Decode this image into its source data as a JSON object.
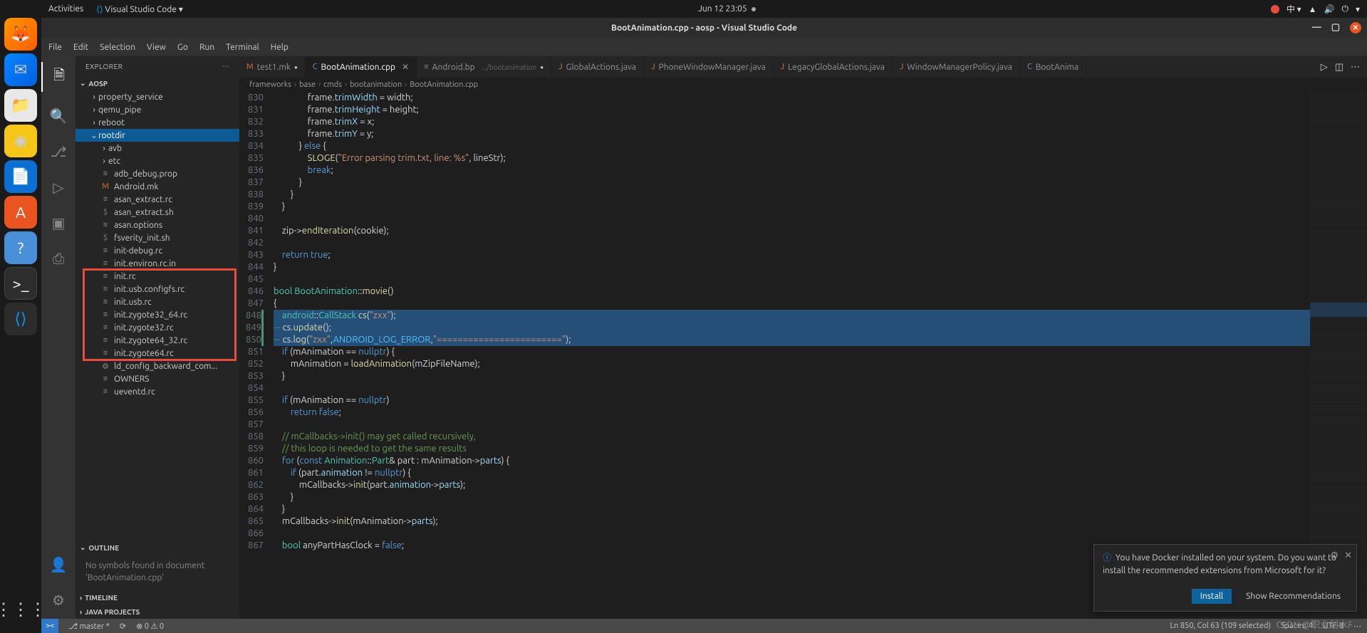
{
  "topbar": {
    "activities": "Activities",
    "app": "Visual Studio Code ▾",
    "clock": "Jun 12  23:05",
    "lang": "中 ▾"
  },
  "window": {
    "title": "BootAnimation.cpp - aosp - Visual Studio Code"
  },
  "menubar": [
    "File",
    "Edit",
    "Selection",
    "View",
    "Go",
    "Run",
    "Terminal",
    "Help"
  ],
  "sidebar": {
    "title": "EXPLORER",
    "project": "AOSP",
    "outline_head": "OUTLINE",
    "outline_empty": "No symbols found in document 'BootAnimation.cpp'",
    "timeline_head": "TIMELINE",
    "java_head": "JAVA PROJECTS",
    "tree": [
      {
        "type": "folder",
        "label": "property_service",
        "depth": 1
      },
      {
        "type": "folder",
        "label": "qemu_pipe",
        "depth": 1
      },
      {
        "type": "folder",
        "label": "reboot",
        "depth": 1
      },
      {
        "type": "folder",
        "label": "rootdir",
        "depth": 1,
        "expanded": true,
        "selected": true
      },
      {
        "type": "folder",
        "label": "avb",
        "depth": 2
      },
      {
        "type": "folder",
        "label": "etc",
        "depth": 2
      },
      {
        "type": "file",
        "label": "adb_debug.prop",
        "icon": "≡",
        "depth": 2
      },
      {
        "type": "file",
        "label": "Android.mk",
        "icon": "M",
        "color": "#e37933",
        "depth": 2
      },
      {
        "type": "file",
        "label": "asan_extract.rc",
        "icon": "≡",
        "depth": 2
      },
      {
        "type": "file",
        "label": "asan_extract.sh",
        "icon": "$",
        "depth": 2
      },
      {
        "type": "file",
        "label": "asan.options",
        "icon": "≡",
        "depth": 2
      },
      {
        "type": "file",
        "label": "fsverity_init.sh",
        "icon": "$",
        "depth": 2
      },
      {
        "type": "file",
        "label": "init-debug.rc",
        "icon": "≡",
        "depth": 2
      },
      {
        "type": "file",
        "label": "init.environ.rc.in",
        "icon": "≡",
        "depth": 2
      },
      {
        "type": "file",
        "label": "init.rc",
        "icon": "≡",
        "depth": 2,
        "boxed": true
      },
      {
        "type": "file",
        "label": "init.usb.configfs.rc",
        "icon": "≡",
        "depth": 2,
        "boxed": true
      },
      {
        "type": "file",
        "label": "init.usb.rc",
        "icon": "≡",
        "depth": 2,
        "boxed": true
      },
      {
        "type": "file",
        "label": "init.zygote32_64.rc",
        "icon": "≡",
        "depth": 2,
        "boxed": true
      },
      {
        "type": "file",
        "label": "init.zygote32.rc",
        "icon": "≡",
        "depth": 2,
        "boxed": true
      },
      {
        "type": "file",
        "label": "init.zygote64_32.rc",
        "icon": "≡",
        "depth": 2,
        "boxed": true
      },
      {
        "type": "file",
        "label": "init.zygote64.rc",
        "icon": "≡",
        "depth": 2,
        "boxed": true
      },
      {
        "type": "file",
        "label": "ld_config_backward_com...",
        "icon": "⚙",
        "depth": 2
      },
      {
        "type": "file",
        "label": "OWNERS",
        "icon": "≡",
        "depth": 2
      },
      {
        "type": "file",
        "label": "ueventd.rc",
        "icon": "≡",
        "depth": 2
      }
    ]
  },
  "tabs": [
    {
      "label": "test1.mk",
      "icon": "M",
      "iconColor": "#e37933",
      "modified": true
    },
    {
      "label": "BootAnimation.cpp",
      "icon": "C",
      "iconColor": "#659ad2",
      "modified": true,
      "active": true
    },
    {
      "label": "Android.bp",
      "icon": "≡",
      "iconColor": "#888",
      "hint": ".../bootanimation",
      "modified": true
    },
    {
      "label": "GlobalActions.java",
      "icon": "J",
      "iconColor": "#e8762d"
    },
    {
      "label": "PhoneWindowManager.java",
      "icon": "J",
      "iconColor": "#e8762d"
    },
    {
      "label": "LegacyGlobalActions.java",
      "icon": "J",
      "iconColor": "#e8762d"
    },
    {
      "label": "WindowManagerPolicy.java",
      "icon": "J",
      "iconColor": "#e8762d"
    },
    {
      "label": "BootAnima",
      "icon": "C",
      "iconColor": "#659ad2"
    }
  ],
  "breadcrumbs": [
    "frameworks",
    "base",
    "cmds",
    "bootanimation",
    "BootAnimation.cpp"
  ],
  "code": {
    "start": 830,
    "lines": [
      {
        "n": 830,
        "html": "                frame.<span class='tok-prop'>trimWidth</span> = width;"
      },
      {
        "n": 831,
        "html": "                frame.<span class='tok-prop'>trimHeight</span> = height;"
      },
      {
        "n": 832,
        "html": "                frame.<span class='tok-prop'>trimX</span> = x;"
      },
      {
        "n": 833,
        "html": "                frame.<span class='tok-prop'>trimY</span> = y;"
      },
      {
        "n": 834,
        "html": "            } <span class='tok-kw'>else</span> {"
      },
      {
        "n": 835,
        "html": "                <span class='tok-fn'>SLOGE</span>(<span class='tok-str'>\"Error parsing trim.txt, line: %s\"</span>, lineStr);"
      },
      {
        "n": 836,
        "html": "                <span class='tok-kw'>break</span>;"
      },
      {
        "n": 837,
        "html": "            }"
      },
      {
        "n": 838,
        "html": "        }"
      },
      {
        "n": 839,
        "html": "    }"
      },
      {
        "n": 840,
        "html": ""
      },
      {
        "n": 841,
        "html": "    zip-&gt;<span class='tok-fn'>endIteration</span>(cookie);"
      },
      {
        "n": 842,
        "html": ""
      },
      {
        "n": 843,
        "html": "    <span class='tok-kw'>return</span> <span class='tok-kw'>true</span>;"
      },
      {
        "n": 844,
        "html": "}"
      },
      {
        "n": 845,
        "html": ""
      },
      {
        "n": 846,
        "html": "<span class='tok-type'>bool</span> <span class='tok-type'>BootAnimation</span>::<span class='tok-fn'>movie</span>()"
      },
      {
        "n": 847,
        "html": "{"
      },
      {
        "n": 848,
        "html": "    <span class='tok-type'>android</span>::<span class='tok-type'>CallStack</span> <span class='tok-fn'>cs</span>(<span class='tok-str'>\"zxx\"</span>);",
        "sel": true,
        "mod": true
      },
      {
        "n": 849,
        "html": "<span class='tok-com'>···</span> cs.<span class='tok-fn'>update</span>();",
        "sel": true,
        "mod": true
      },
      {
        "n": 850,
        "html": "<span class='tok-com'>···</span> cs.<span class='tok-fn'>log</span>(<span class='tok-str'>\"zxx\"</span>,<span class='tok-const'>ANDROID_LOG_ERROR</span>,<span class='tok-str'>\"========================\"</span>);",
        "sel": true,
        "mod": true
      },
      {
        "n": 851,
        "html": "    <span class='tok-kw'>if</span> (mAnimation == <span class='tok-kw'>nullptr</span>) {"
      },
      {
        "n": 852,
        "html": "        mAnimation = <span class='tok-fn'>loadAnimation</span>(mZipFileName);"
      },
      {
        "n": 853,
        "html": "    }"
      },
      {
        "n": 854,
        "html": ""
      },
      {
        "n": 855,
        "html": "    <span class='tok-kw'>if</span> (mAnimation == <span class='tok-kw'>nullptr</span>)"
      },
      {
        "n": 856,
        "html": "        <span class='tok-kw'>return</span> <span class='tok-kw'>false</span>;"
      },
      {
        "n": 857,
        "html": ""
      },
      {
        "n": 858,
        "html": "    <span class='tok-com'>// mCallbacks-&gt;init() may get called recursively,</span>"
      },
      {
        "n": 859,
        "html": "    <span class='tok-com'>// this loop is needed to get the same results</span>"
      },
      {
        "n": 860,
        "html": "    <span class='tok-kw'>for</span> (<span class='tok-kw'>const</span> <span class='tok-type'>Animation</span>::<span class='tok-type'>Part</span>&amp; part : mAnimation-&gt;<span class='tok-prop'>parts</span>) {"
      },
      {
        "n": 861,
        "html": "        <span class='tok-kw'>if</span> (part.<span class='tok-prop'>animation</span> != <span class='tok-kw'>nullptr</span>) {"
      },
      {
        "n": 862,
        "html": "            mCallbacks-&gt;<span class='tok-fn'>init</span>(part.<span class='tok-prop'>animation</span>-&gt;<span class='tok-prop'>parts</span>);"
      },
      {
        "n": 863,
        "html": "        }"
      },
      {
        "n": 864,
        "html": "    }"
      },
      {
        "n": 865,
        "html": "    mCallbacks-&gt;<span class='tok-fn'>init</span>(mAnimation-&gt;<span class='tok-prop'>parts</span>);"
      },
      {
        "n": 866,
        "html": ""
      },
      {
        "n": 867,
        "html": "    <span class='tok-type'>bool</span> anyPartHasClock = <span class='tok-kw'>false</span>;"
      }
    ]
  },
  "notification": {
    "text": "You have Docker installed on your system. Do you want to install the recommended extensions from Microsoft for it?",
    "primary": "Install",
    "secondary": "Show Recommendations"
  },
  "statusbar": {
    "branch": "master *",
    "sync": "⟳",
    "errors": "⊗ 0  ⚠ 0",
    "position": "Ln 850, Col 63 (109 selected)",
    "spaces": "Spaces: 4",
    "encoding": "UTF-8",
    "misc": "⋯"
  },
  "watermark": "CSDN @职业划水F"
}
